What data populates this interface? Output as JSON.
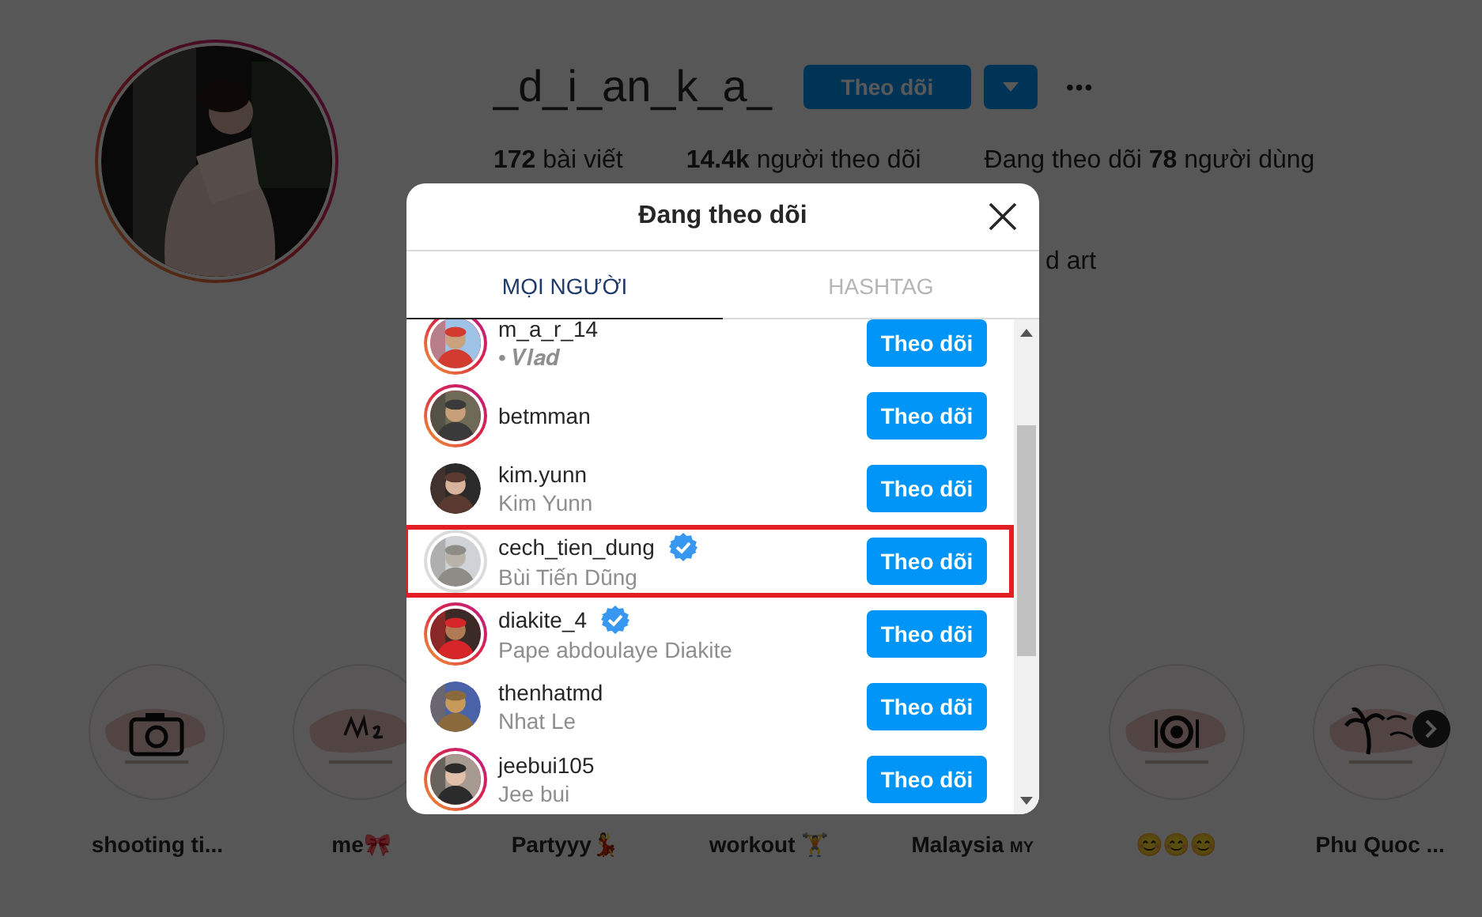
{
  "profile": {
    "username": "_d_i_an_k_a_",
    "follow_button": "Theo dõi",
    "more_button": "•••",
    "stats": [
      {
        "count": "172",
        "label": "bài viết"
      },
      {
        "count": "14.4k",
        "label": "người theo dõi"
      },
      {
        "prefix": "Đang theo dõi",
        "count": "78",
        "label": "người dùng"
      }
    ],
    "bio": "d art"
  },
  "highlights": [
    {
      "label": "shooting ti...",
      "kind": "camera"
    },
    {
      "label": "me🎀",
      "kind": "scribble"
    },
    {
      "label": "Partyyy💃"
    },
    {
      "label": "workout 🏋"
    },
    {
      "label": "Malaysia",
      "flag": "MY"
    },
    {
      "label": "😊😊😊",
      "kind": "plate"
    },
    {
      "label": "Phu Quoc ...",
      "kind": "palm"
    }
  ],
  "modal": {
    "title": "Đang theo dõi",
    "tabs": [
      {
        "label": "MỌI NGƯỜI",
        "selected": true
      },
      {
        "label": "HASHTAG",
        "selected": false
      }
    ],
    "rows": [
      {
        "username": "m_a_r_14",
        "name": "• 𝑽𝒍𝒂𝒅",
        "verified": false,
        "story_ring": true,
        "story_seen": false,
        "highlighted": false,
        "button": "Theo dõi"
      },
      {
        "username": "betmman",
        "verified": false,
        "story_ring": true,
        "story_seen": false,
        "highlighted": false,
        "button": "Theo dõi"
      },
      {
        "username": "kim.yunn",
        "name": "Kim Yunn",
        "verified": false,
        "story_ring": false,
        "highlighted": false,
        "button": "Theo dõi"
      },
      {
        "username": "cech_tien_dung",
        "name": "Bùi Tiến Dũng",
        "verified": true,
        "story_ring": true,
        "story_seen": true,
        "highlighted": true,
        "button": "Theo dõi"
      },
      {
        "username": "diakite_4",
        "name": "Pape abdoulaye Diakite",
        "verified": true,
        "story_ring": true,
        "story_seen": false,
        "highlighted": false,
        "button": "Theo dõi"
      },
      {
        "username": "thenhatmd",
        "name": "Nhat Le",
        "verified": false,
        "story_ring": false,
        "highlighted": false,
        "button": "Theo dõi"
      },
      {
        "username": "jeebui105",
        "name": "Jee bui",
        "verified": false,
        "story_ring": true,
        "story_seen": false,
        "highlighted": false,
        "button": "Theo dõi"
      }
    ]
  }
}
